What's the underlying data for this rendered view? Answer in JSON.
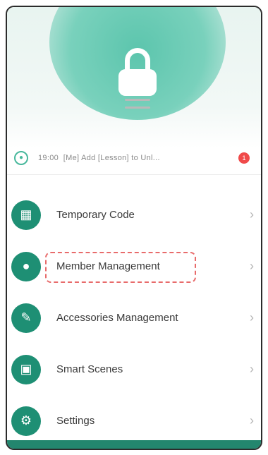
{
  "log": {
    "time": "19:00",
    "text": "[Me] Add [Lesson] to Unl...",
    "badge": "1"
  },
  "menu": {
    "items": [
      {
        "label": "Temporary Code",
        "icon": "keypad-icon",
        "glyph": "▦"
      },
      {
        "label": "Member Management",
        "icon": "person-icon",
        "glyph": "●"
      },
      {
        "label": "Accessories Management",
        "icon": "brush-icon",
        "glyph": "✎"
      },
      {
        "label": "Smart Scenes",
        "icon": "scene-icon",
        "glyph": "▣"
      },
      {
        "label": "Settings",
        "icon": "gear-icon",
        "glyph": "⚙"
      }
    ],
    "chevron": "›"
  },
  "colors": {
    "accent": "#1e8f74",
    "accent_light": "#5cc5ad",
    "alert": "#f04a4a",
    "highlight": "#e86b6b"
  }
}
